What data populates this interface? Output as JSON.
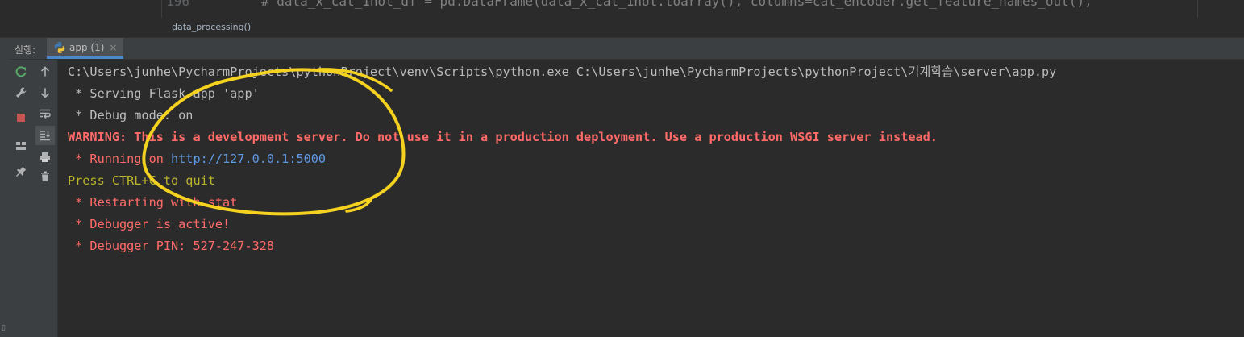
{
  "editor": {
    "line_number": "196",
    "code_line": "# data_x_cat_1hot_df = pd.DataFrame(data_x_cat_1hot.toarray(), columns=cat_encoder.get_feature_names_out(),",
    "breadcrumb": "data_processing()"
  },
  "run_panel": {
    "label": "실행:",
    "tab_label": "app (1)",
    "tab_close": "×"
  },
  "toolbar_icons": {
    "left": [
      "rerun-icon",
      "wrench-icon",
      "stop-icon",
      "layout-icon",
      "pin-icon"
    ],
    "right": [
      "up-arrow-icon",
      "down-arrow-icon",
      "soft-wrap-icon",
      "scroll-to-end-icon",
      "print-icon",
      "trash-icon"
    ]
  },
  "console": {
    "cmd": "C:\\Users\\junhe\\PycharmProjects\\pythonProject\\venv\\Scripts\\python.exe C:\\Users\\junhe\\PycharmProjects\\pythonProject\\기계학습\\server\\app.py",
    "serving": " * Serving Flask app 'app'",
    "debug_mode": " * Debug mode: on",
    "warning": "WARNING: This is a development server. Do not use it in a production deployment. Use a production WSGI server instead.",
    "running_prefix": " * Running on ",
    "running_url": "http://127.0.0.1:5000",
    "quit": "Press CTRL+C to quit",
    "restarting": " * Restarting with stat",
    "debugger_active": " * Debugger is active!",
    "debugger_pin": " * Debugger PIN: 527-247-328"
  },
  "colors": {
    "background": "#2b2b2b",
    "stderr_red": "#ff6b68",
    "quit_yellow": "#bbb529",
    "link_blue": "#5e9ae4",
    "annotation_yellow": "#f5d21f"
  }
}
